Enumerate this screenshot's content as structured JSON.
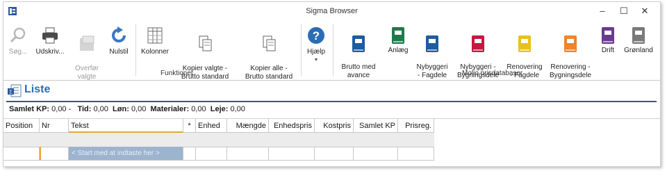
{
  "window": {
    "title": "Sigma Browser",
    "controls": [
      "–",
      "☐",
      "✕"
    ]
  },
  "ribbon": {
    "buttons": [
      {
        "label": "Søg...",
        "enabled": false
      },
      {
        "label": "Udskriv...",
        "enabled": true
      },
      {
        "label": "Overfør\nvalgte",
        "enabled": false
      },
      {
        "label": "Nulstil",
        "enabled": true
      },
      {
        "label": "Kolonner",
        "enabled": true
      },
      {
        "label": "Kopier valgte -\nBrutto standard",
        "enabled": true
      },
      {
        "label": "Kopier alle -\nBrutto standard",
        "enabled": true
      },
      {
        "label": "Hjælp",
        "enabled": true
      },
      {
        "label": "Brutto med\navance",
        "enabled": true
      },
      {
        "label": "Anlæg",
        "enabled": true,
        "color": "#1e7a4e"
      },
      {
        "label": "Nybyggeri\n- Fagdele",
        "enabled": true,
        "color": "#1d5c9e"
      },
      {
        "label": "Nybyggeri -\nBygningsdele",
        "enabled": true,
        "color": "#1d5c9e"
      },
      {
        "label": "Renovering\n- Fagdele",
        "enabled": true,
        "color": "#e8c21a"
      },
      {
        "label": "Renovering -\nBygningsdele",
        "enabled": true,
        "color": "#f0842a"
      },
      {
        "label": "Drift",
        "enabled": true,
        "color": "#6a3a8f"
      },
      {
        "label": "Grønland",
        "enabled": true,
        "color": "#7a7a7a"
      }
    ],
    "group_labels": {
      "funktioner": "Funktioner",
      "molio": "Molio prisdatabaser"
    }
  },
  "list": {
    "title": "Liste"
  },
  "summary": {
    "samlet_kp_label": "Samlet KP:",
    "samlet_kp_value": "0,00",
    "dash": "-",
    "tid_label": "Tid:",
    "tid_value": "0,00",
    "lon_label": "Løn:",
    "lon_value": "0,00",
    "materialer_label": "Materialer:",
    "materialer_value": "0,00",
    "leje_label": "Leje:",
    "leje_value": "0,00"
  },
  "table": {
    "columns": [
      "Position",
      "Nr",
      "Tekst",
      "*",
      "Enhed",
      "Mængde",
      "Enhedspris",
      "Kostpris",
      "Samlet KP",
      "Prisreg."
    ],
    "start_placeholder": "< Start med at indtaste her >"
  }
}
